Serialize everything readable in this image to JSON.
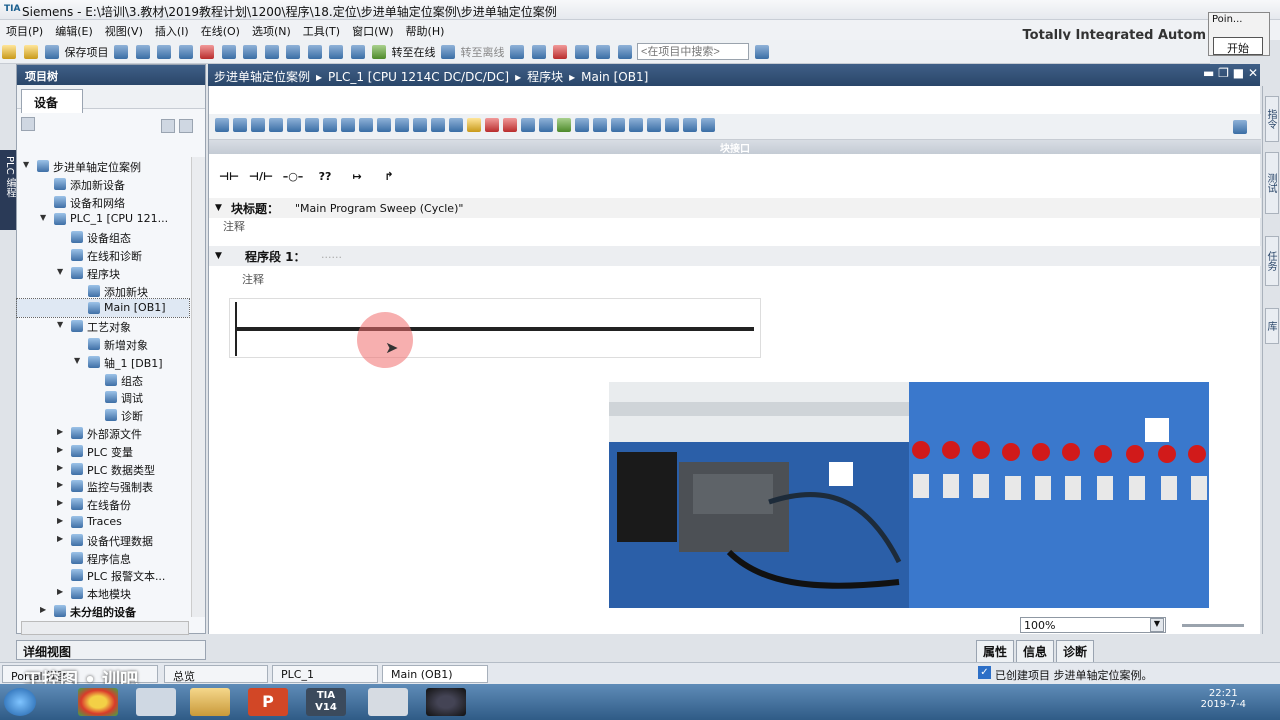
{
  "window": {
    "title": "Siemens  -  E:\\培训\\3.教材\\2019教程计划\\1200\\程序\\18.定位\\步进单轴定位案例\\步进单轴定位案例",
    "logo": "TIA",
    "brand": "Totally Integrated Autom"
  },
  "menu": [
    "项目(P)",
    "编辑(E)",
    "视图(V)",
    "插入(I)",
    "在线(O)",
    "选项(N)",
    "工具(T)",
    "窗口(W)",
    "帮助(H)"
  ],
  "toolbar": {
    "save_label": "保存项目",
    "go_online": "转至在线",
    "go_offline": "转至离线",
    "search_placeholder": "<在项目中搜索>"
  },
  "popup": {
    "title": "Poin...",
    "button": "开始"
  },
  "left_panel": {
    "header": "项目树",
    "tab": "设备",
    "side_label": "PLC 编程",
    "tree": [
      {
        "label": "步进单轴定位案例",
        "level": 0,
        "arrow": "down"
      },
      {
        "label": "添加新设备",
        "level": 1,
        "arrow": ""
      },
      {
        "label": "设备和网络",
        "level": 1,
        "arrow": ""
      },
      {
        "label": "PLC_1 [CPU 121...",
        "level": 1,
        "arrow": "down"
      },
      {
        "label": "设备组态",
        "level": 2,
        "arrow": ""
      },
      {
        "label": "在线和诊断",
        "level": 2,
        "arrow": ""
      },
      {
        "label": "程序块",
        "level": 2,
        "arrow": "down"
      },
      {
        "label": "添加新块",
        "level": 3,
        "arrow": ""
      },
      {
        "label": "Main [OB1]",
        "level": 3,
        "arrow": "",
        "selected": true
      },
      {
        "label": "工艺对象",
        "level": 2,
        "arrow": "down"
      },
      {
        "label": "新增对象",
        "level": 3,
        "arrow": ""
      },
      {
        "label": "轴_1 [DB1]",
        "level": 3,
        "arrow": "down"
      },
      {
        "label": "组态",
        "level": 4,
        "arrow": ""
      },
      {
        "label": "调试",
        "level": 4,
        "arrow": ""
      },
      {
        "label": "诊断",
        "level": 4,
        "arrow": ""
      },
      {
        "label": "外部源文件",
        "level": 2,
        "arrow": "right"
      },
      {
        "label": "PLC 变量",
        "level": 2,
        "arrow": "right"
      },
      {
        "label": "PLC 数据类型",
        "level": 2,
        "arrow": "right"
      },
      {
        "label": "监控与强制表",
        "level": 2,
        "arrow": "right"
      },
      {
        "label": "在线备份",
        "level": 2,
        "arrow": "right"
      },
      {
        "label": "Traces",
        "level": 2,
        "arrow": "right"
      },
      {
        "label": "设备代理数据",
        "level": 2,
        "arrow": "right"
      },
      {
        "label": "程序信息",
        "level": 2,
        "arrow": ""
      },
      {
        "label": "PLC 报警文本...",
        "level": 2,
        "arrow": ""
      },
      {
        "label": "本地模块",
        "level": 2,
        "arrow": "right"
      },
      {
        "label": "未分组的设备",
        "level": 1,
        "arrow": "right"
      }
    ],
    "detail_view": "详细视图"
  },
  "editor": {
    "breadcrumb": [
      "步进单轴定位案例",
      "PLC_1 [CPU 1214C DC/DC/DC]",
      "程序块",
      "Main [OB1]"
    ],
    "interface_band": "块接口",
    "ladder_symbols": [
      "⊣⊢",
      "⊣/⊢",
      "–○–",
      "??",
      "↦",
      "↱"
    ],
    "block_title_label": "块标题：",
    "block_title_value": "\"Main Program Sweep (Cycle)\"",
    "comment": "注释",
    "network_label": "程序段 1：",
    "network_dots": "......",
    "network_comment": "注释",
    "zoom": "100%"
  },
  "right_tabs": [
    "指令",
    "测试",
    "任务",
    "库"
  ],
  "inspector_tabs": [
    "属性",
    "信息",
    "诊断"
  ],
  "portal": {
    "portal_view": "Portal 视图",
    "tabs": [
      "总览",
      "PLC_1",
      "Main (OB1)"
    ],
    "status": "已创建项目 步进单轴定位案例。"
  },
  "taskbar": {
    "apps": [
      "Chrome",
      "Explorer",
      "PowerPoint",
      "TIA V14",
      "Paint",
      "Camera"
    ],
    "tia_label": "TIA\nV14",
    "time": "22:21",
    "date": "2019-7-4"
  },
  "watermark": "工控图 • 训吧"
}
